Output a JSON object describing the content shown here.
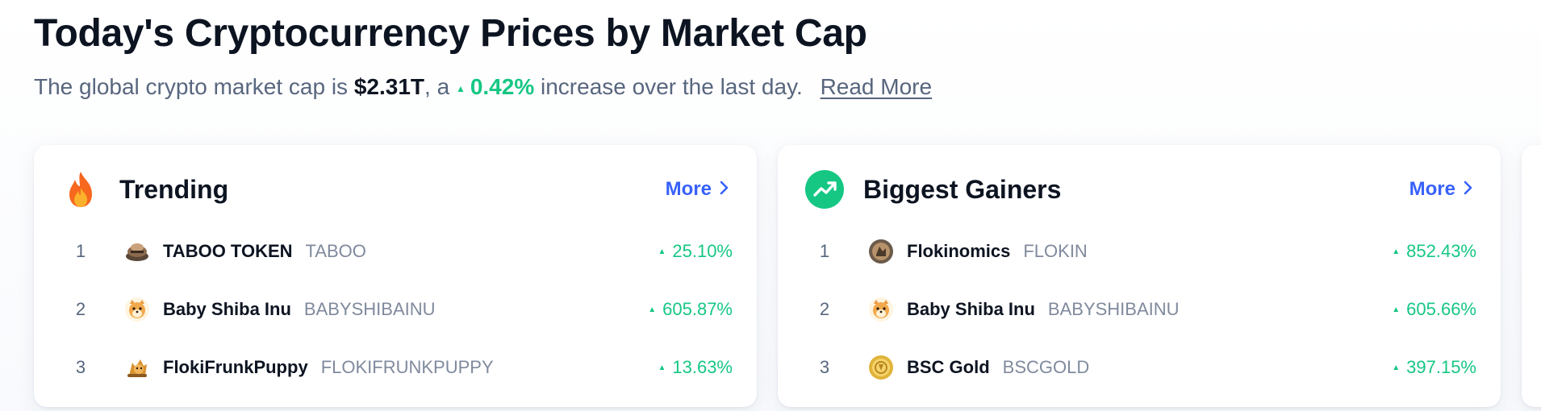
{
  "header": {
    "title": "Today's Cryptocurrency Prices by Market Cap",
    "subtitle_prefix": "The global crypto market cap is",
    "market_cap": "$2.31T",
    "subtitle_mid": ", a",
    "change": "0.42%",
    "subtitle_suffix": "increase over the last day.",
    "read_more": "Read More"
  },
  "colors": {
    "up": "#16c784",
    "link": "#3861fb",
    "text_primary": "#0d1421",
    "text_secondary": "#58667e"
  },
  "trending": {
    "title": "Trending",
    "icon": "fire-icon",
    "more_label": "More",
    "items": [
      {
        "rank": "1",
        "name": "TABOO TOKEN",
        "symbol": "TABOO",
        "change": "25.10%",
        "logo": "taboo-logo"
      },
      {
        "rank": "2",
        "name": "Baby Shiba Inu",
        "symbol": "BABYSHIBAINU",
        "change": "605.87%",
        "logo": "baby-shiba-logo"
      },
      {
        "rank": "3",
        "name": "FlokiFrunkPuppy",
        "symbol": "FLOKIFRUNKPUPPY",
        "change": "13.63%",
        "logo": "floki-frunk-logo"
      }
    ]
  },
  "gainers": {
    "title": "Biggest Gainers",
    "icon": "trending-up-icon",
    "more_label": "More",
    "items": [
      {
        "rank": "1",
        "name": "Flokinomics",
        "symbol": "FLOKIN",
        "change": "852.43%",
        "logo": "flokinomics-logo"
      },
      {
        "rank": "2",
        "name": "Baby Shiba Inu",
        "symbol": "BABYSHIBAINU",
        "change": "605.66%",
        "logo": "baby-shiba-logo"
      },
      {
        "rank": "3",
        "name": "BSC Gold",
        "symbol": "BSCGOLD",
        "change": "397.15%",
        "logo": "bsc-gold-logo"
      }
    ]
  }
}
